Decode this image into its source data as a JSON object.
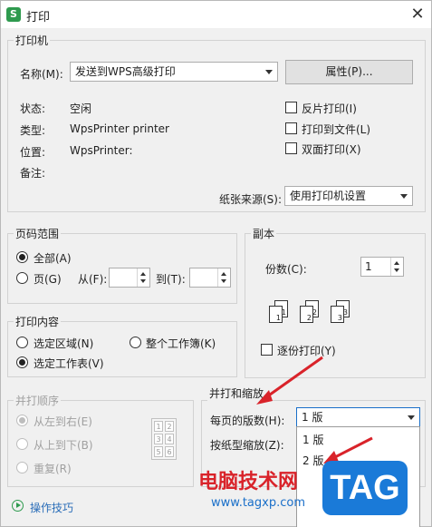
{
  "window": {
    "title": "打印",
    "app_icon_letter": "S"
  },
  "printer": {
    "group": "打印机",
    "name_label": "名称(M):",
    "name_value": "发送到WPS高级打印",
    "properties_button": "属性(P)...",
    "status_label": "状态:",
    "status_value": "空闲",
    "type_label": "类型:",
    "type_value": "WpsPrinter printer",
    "location_label": "位置:",
    "location_value": "WpsPrinter:",
    "comment_label": "备注:",
    "reverse_print": "反片打印(I)",
    "print_to_file": "打印到文件(L)",
    "duplex_print": "双面打印(X)",
    "paper_source_label": "纸张来源(S):",
    "paper_source_value": "使用打印机设置"
  },
  "page_range": {
    "group": "页码范围",
    "all": "全部(A)",
    "pages": "页(G)",
    "from_label": "从(F):",
    "to_label": "到(T):"
  },
  "copies": {
    "group": "副本",
    "count_label": "份数(C):",
    "count_value": "1",
    "collate": "逐份打印(Y)"
  },
  "print_content": {
    "group": "打印内容",
    "selection": "选定区域(N)",
    "whole_workbook": "整个工作簿(K)",
    "selected_sheet": "选定工作表(V)"
  },
  "print_order": {
    "group": "并打顺序",
    "left_to_right": "从左到右(E)",
    "top_to_bottom": "从上到下(B)",
    "repeat": "重复(R)",
    "grid_numbers": [
      "1",
      "2",
      "3",
      "4",
      "5",
      "6"
    ]
  },
  "scaling": {
    "group": "并打和缩放",
    "pages_per_sheet_label": "每页的版数(H):",
    "pages_per_sheet_value": "1 版",
    "scale_to_paper_label": "按纸型缩放(Z):",
    "dropdown_options": [
      "1 版",
      "2 版"
    ]
  },
  "footer": {
    "tips_link": "操作技巧"
  },
  "watermarks": {
    "site_name": "电脑技术网",
    "site_url": "www.tagxp.com",
    "tag_logo": "TAG"
  }
}
